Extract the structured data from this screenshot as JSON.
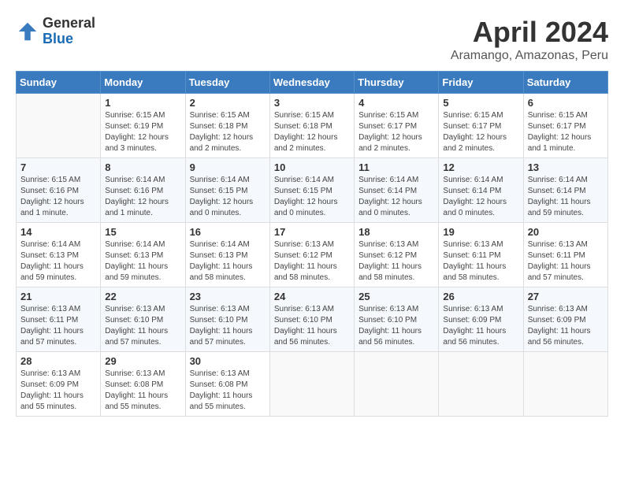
{
  "header": {
    "logo_general": "General",
    "logo_blue": "Blue",
    "month": "April 2024",
    "location": "Aramango, Amazonas, Peru"
  },
  "days_of_week": [
    "Sunday",
    "Monday",
    "Tuesday",
    "Wednesday",
    "Thursday",
    "Friday",
    "Saturday"
  ],
  "weeks": [
    [
      {
        "day": "",
        "sunrise": "",
        "sunset": "",
        "daylight": "",
        "empty": true
      },
      {
        "day": "1",
        "sunrise": "Sunrise: 6:15 AM",
        "sunset": "Sunset: 6:19 PM",
        "daylight": "Daylight: 12 hours and 3 minutes."
      },
      {
        "day": "2",
        "sunrise": "Sunrise: 6:15 AM",
        "sunset": "Sunset: 6:18 PM",
        "daylight": "Daylight: 12 hours and 2 minutes."
      },
      {
        "day": "3",
        "sunrise": "Sunrise: 6:15 AM",
        "sunset": "Sunset: 6:18 PM",
        "daylight": "Daylight: 12 hours and 2 minutes."
      },
      {
        "day": "4",
        "sunrise": "Sunrise: 6:15 AM",
        "sunset": "Sunset: 6:17 PM",
        "daylight": "Daylight: 12 hours and 2 minutes."
      },
      {
        "day": "5",
        "sunrise": "Sunrise: 6:15 AM",
        "sunset": "Sunset: 6:17 PM",
        "daylight": "Daylight: 12 hours and 2 minutes."
      },
      {
        "day": "6",
        "sunrise": "Sunrise: 6:15 AM",
        "sunset": "Sunset: 6:17 PM",
        "daylight": "Daylight: 12 hours and 1 minute."
      }
    ],
    [
      {
        "day": "7",
        "sunrise": "Sunrise: 6:15 AM",
        "sunset": "Sunset: 6:16 PM",
        "daylight": "Daylight: 12 hours and 1 minute."
      },
      {
        "day": "8",
        "sunrise": "Sunrise: 6:14 AM",
        "sunset": "Sunset: 6:16 PM",
        "daylight": "Daylight: 12 hours and 1 minute."
      },
      {
        "day": "9",
        "sunrise": "Sunrise: 6:14 AM",
        "sunset": "Sunset: 6:15 PM",
        "daylight": "Daylight: 12 hours and 0 minutes."
      },
      {
        "day": "10",
        "sunrise": "Sunrise: 6:14 AM",
        "sunset": "Sunset: 6:15 PM",
        "daylight": "Daylight: 12 hours and 0 minutes."
      },
      {
        "day": "11",
        "sunrise": "Sunrise: 6:14 AM",
        "sunset": "Sunset: 6:14 PM",
        "daylight": "Daylight: 12 hours and 0 minutes."
      },
      {
        "day": "12",
        "sunrise": "Sunrise: 6:14 AM",
        "sunset": "Sunset: 6:14 PM",
        "daylight": "Daylight: 12 hours and 0 minutes."
      },
      {
        "day": "13",
        "sunrise": "Sunrise: 6:14 AM",
        "sunset": "Sunset: 6:14 PM",
        "daylight": "Daylight: 11 hours and 59 minutes."
      }
    ],
    [
      {
        "day": "14",
        "sunrise": "Sunrise: 6:14 AM",
        "sunset": "Sunset: 6:13 PM",
        "daylight": "Daylight: 11 hours and 59 minutes."
      },
      {
        "day": "15",
        "sunrise": "Sunrise: 6:14 AM",
        "sunset": "Sunset: 6:13 PM",
        "daylight": "Daylight: 11 hours and 59 minutes."
      },
      {
        "day": "16",
        "sunrise": "Sunrise: 6:14 AM",
        "sunset": "Sunset: 6:13 PM",
        "daylight": "Daylight: 11 hours and 58 minutes."
      },
      {
        "day": "17",
        "sunrise": "Sunrise: 6:13 AM",
        "sunset": "Sunset: 6:12 PM",
        "daylight": "Daylight: 11 hours and 58 minutes."
      },
      {
        "day": "18",
        "sunrise": "Sunrise: 6:13 AM",
        "sunset": "Sunset: 6:12 PM",
        "daylight": "Daylight: 11 hours and 58 minutes."
      },
      {
        "day": "19",
        "sunrise": "Sunrise: 6:13 AM",
        "sunset": "Sunset: 6:11 PM",
        "daylight": "Daylight: 11 hours and 58 minutes."
      },
      {
        "day": "20",
        "sunrise": "Sunrise: 6:13 AM",
        "sunset": "Sunset: 6:11 PM",
        "daylight": "Daylight: 11 hours and 57 minutes."
      }
    ],
    [
      {
        "day": "21",
        "sunrise": "Sunrise: 6:13 AM",
        "sunset": "Sunset: 6:11 PM",
        "daylight": "Daylight: 11 hours and 57 minutes."
      },
      {
        "day": "22",
        "sunrise": "Sunrise: 6:13 AM",
        "sunset": "Sunset: 6:10 PM",
        "daylight": "Daylight: 11 hours and 57 minutes."
      },
      {
        "day": "23",
        "sunrise": "Sunrise: 6:13 AM",
        "sunset": "Sunset: 6:10 PM",
        "daylight": "Daylight: 11 hours and 57 minutes."
      },
      {
        "day": "24",
        "sunrise": "Sunrise: 6:13 AM",
        "sunset": "Sunset: 6:10 PM",
        "daylight": "Daylight: 11 hours and 56 minutes."
      },
      {
        "day": "25",
        "sunrise": "Sunrise: 6:13 AM",
        "sunset": "Sunset: 6:10 PM",
        "daylight": "Daylight: 11 hours and 56 minutes."
      },
      {
        "day": "26",
        "sunrise": "Sunrise: 6:13 AM",
        "sunset": "Sunset: 6:09 PM",
        "daylight": "Daylight: 11 hours and 56 minutes."
      },
      {
        "day": "27",
        "sunrise": "Sunrise: 6:13 AM",
        "sunset": "Sunset: 6:09 PM",
        "daylight": "Daylight: 11 hours and 56 minutes."
      }
    ],
    [
      {
        "day": "28",
        "sunrise": "Sunrise: 6:13 AM",
        "sunset": "Sunset: 6:09 PM",
        "daylight": "Daylight: 11 hours and 55 minutes."
      },
      {
        "day": "29",
        "sunrise": "Sunrise: 6:13 AM",
        "sunset": "Sunset: 6:08 PM",
        "daylight": "Daylight: 11 hours and 55 minutes."
      },
      {
        "day": "30",
        "sunrise": "Sunrise: 6:13 AM",
        "sunset": "Sunset: 6:08 PM",
        "daylight": "Daylight: 11 hours and 55 minutes."
      },
      {
        "day": "",
        "sunrise": "",
        "sunset": "",
        "daylight": "",
        "empty": true
      },
      {
        "day": "",
        "sunrise": "",
        "sunset": "",
        "daylight": "",
        "empty": true
      },
      {
        "day": "",
        "sunrise": "",
        "sunset": "",
        "daylight": "",
        "empty": true
      },
      {
        "day": "",
        "sunrise": "",
        "sunset": "",
        "daylight": "",
        "empty": true
      }
    ]
  ]
}
